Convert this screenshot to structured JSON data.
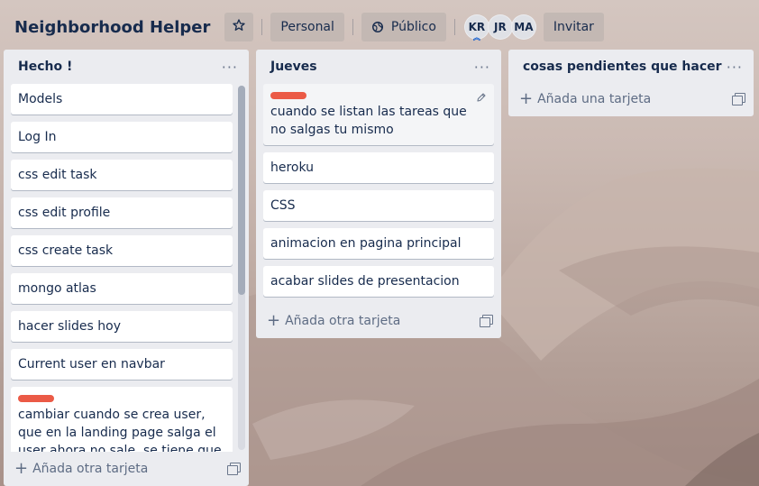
{
  "board": {
    "title": "Neighborhood Helper",
    "star_icon": "star-icon",
    "workspace_label": "Personal",
    "visibility_label": "Público",
    "visibility_icon": "globe-icon",
    "members": [
      "KR",
      "JR",
      "MA"
    ],
    "invite_label": "Invitar"
  },
  "lists": [
    {
      "title": "Hecho !",
      "menu": "···",
      "cards": [
        {
          "text": "Models"
        },
        {
          "text": "Log In"
        },
        {
          "text": "css edit task"
        },
        {
          "text": "css edit profile"
        },
        {
          "text": "css create task"
        },
        {
          "text": "mongo atlas"
        },
        {
          "text": "hacer slides hoy"
        },
        {
          "text": "Current user en navbar"
        },
        {
          "text": "cambiar cuando se crea user, que en la landing page salga el user ahora no sale, se tiene que hacer un redirect",
          "label_color": "#eb5a46"
        }
      ],
      "add_label": "Añada otra tarjeta"
    },
    {
      "title": "Jueves",
      "menu": "···",
      "cards": [
        {
          "text": "cuando se listan las tareas que no salgas tu mismo",
          "label_color": "#eb5a46"
        },
        {
          "text": "heroku"
        },
        {
          "text": "CSS"
        },
        {
          "text": "animacion en pagina principal"
        },
        {
          "text": "acabar slides de presentacion"
        }
      ],
      "add_label": "Añada otra tarjeta"
    },
    {
      "title": "cosas pendientes que hacer",
      "menu": "···",
      "cards": [],
      "add_label": "Añada una tarjeta"
    }
  ],
  "colors": {
    "label_red": "#eb5a46",
    "list_bg": "#ebecf0",
    "text": "#172b4d"
  }
}
